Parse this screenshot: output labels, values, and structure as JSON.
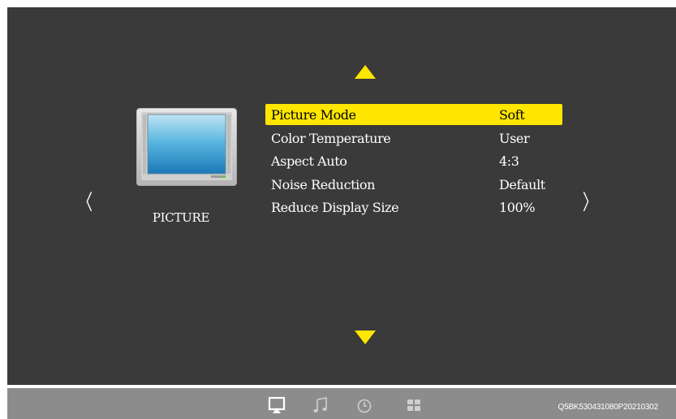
{
  "menu_title": "PICTURE",
  "menu_items": [
    {
      "label": "Picture Mode",
      "value": "Soft",
      "selected": true
    },
    {
      "label": "Color Temperature",
      "value": "User",
      "selected": false
    },
    {
      "label": "Aspect Auto",
      "value": "4:3",
      "selected": false
    },
    {
      "label": "Noise Reduction",
      "value": "Default",
      "selected": false
    },
    {
      "label": "Reduce Display Size",
      "value": "100%",
      "selected": false
    }
  ],
  "nav": {
    "left_glyph": "〈",
    "right_glyph": "〉"
  },
  "bottom_bar": {
    "icons": [
      "picture-tab-icon",
      "music-note-icon",
      "clock-icon",
      "grid-apps-icon"
    ],
    "active_icon": "picture-tab-icon",
    "serial": "Q5BK530431080P20210302"
  },
  "colors": {
    "accent": "#ffe600",
    "screen_bg": "#3a3a3a",
    "bar_bg": "#8c8c8c"
  }
}
